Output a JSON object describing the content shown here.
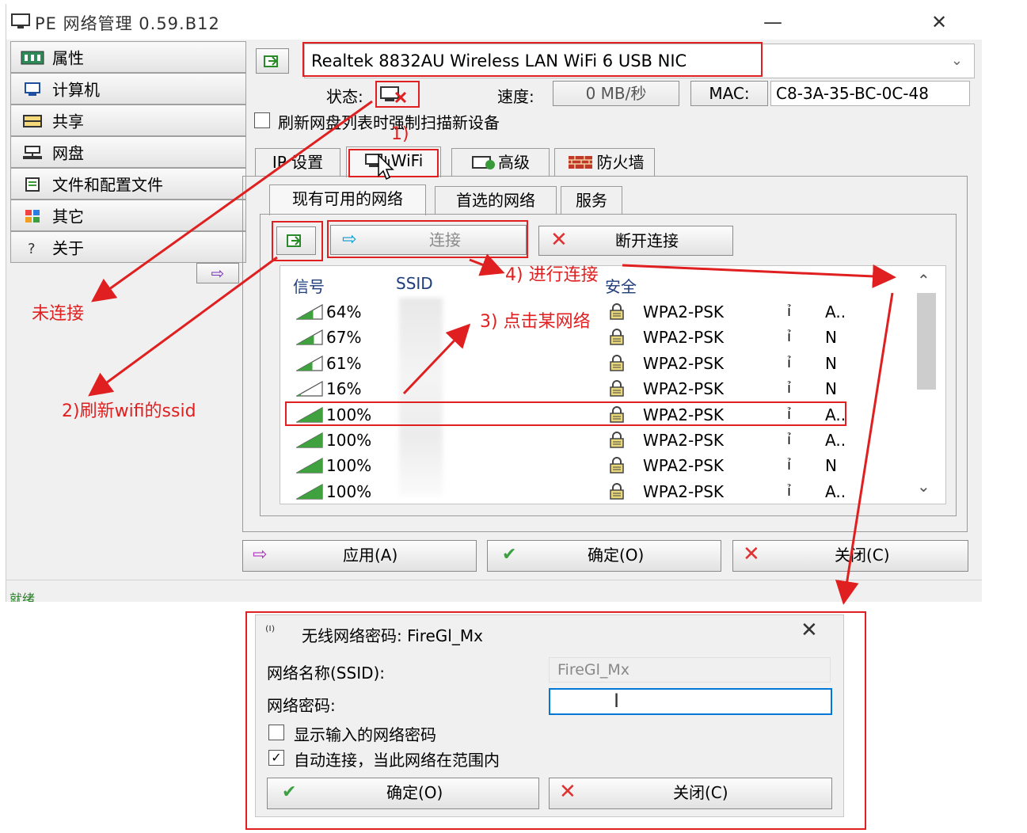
{
  "window": {
    "title": "PE 网络管理 0.59.B12",
    "minimize": "—",
    "close": "✕"
  },
  "sidebar": {
    "items": [
      {
        "label": "属性",
        "icon": "properties-icon"
      },
      {
        "label": "计算机",
        "icon": "computer-icon"
      },
      {
        "label": "共享",
        "icon": "share-icon"
      },
      {
        "label": "网盘",
        "icon": "network-drive-icon"
      },
      {
        "label": "文件和配置文件",
        "icon": "files-icon"
      },
      {
        "label": "其它",
        "icon": "other-icon"
      },
      {
        "label": "关于",
        "icon": "about-icon"
      }
    ],
    "arrow": "⇨"
  },
  "adapter": {
    "name": "Realtek 8832AU Wireless LAN WiFi 6 USB NIC",
    "status_label": "状态:",
    "speed_label": "速度:",
    "speed_value": "0 MB/秒",
    "mac_label": "MAC:",
    "mac_value": "C8-3A-35-BC-0C-48",
    "force_scan_label": "刷新网盘列表时强制扫描新设备"
  },
  "tabs": [
    "IP 设置",
    "WiFi",
    "高级",
    "防火墙"
  ],
  "subtabs": [
    "现有可用的网络",
    "首选的网络",
    "服务"
  ],
  "wifi_buttons": {
    "connect": "连接",
    "disconnect": "断开连接"
  },
  "columns": {
    "signal": "信号",
    "ssid": "SSID",
    "security": "安全"
  },
  "networks": [
    {
      "signal": "64%",
      "security": "WPA2-PSK",
      "extra": "A.."
    },
    {
      "signal": "67%",
      "security": "WPA2-PSK",
      "extra": "N"
    },
    {
      "signal": "61%",
      "security": "WPA2-PSK",
      "extra": "N"
    },
    {
      "signal": "16%",
      "security": "WPA2-PSK",
      "extra": "N"
    },
    {
      "signal": "100%",
      "security": "WPA2-PSK",
      "extra": "A.."
    },
    {
      "signal": "100%",
      "security": "WPA2-PSK",
      "extra": "A.."
    },
    {
      "signal": "100%",
      "security": "WPA2-PSK",
      "extra": "N"
    },
    {
      "signal": "100%",
      "security": "WPA2-PSK",
      "extra": "A.."
    }
  ],
  "bottom_buttons": {
    "apply": "应用(A)",
    "ok": "确定(O)",
    "close": "关闭(C)"
  },
  "statusbar": "就绪",
  "annotations": {
    "step1": "1)",
    "not_connected": "未连接",
    "step2": "2)刷新wifi的ssid",
    "step3": "3) 点击某网络",
    "step4": "4) 进行连接"
  },
  "dialog": {
    "title": "无线网络密码: FireGl_Mx",
    "ssid_label": "网络名称(SSID):",
    "ssid_value": "FireGl_Mx",
    "password_label": "网络密码:",
    "password_value": "",
    "show_password": "显示输入的网络密码",
    "auto_connect": "自动连接，当此网络在范围内",
    "ok": "确定(O)",
    "close": "关闭(C)"
  },
  "colors": {
    "annotation": "#e02020",
    "signal": "#3fa23f",
    "selection": "#0078d7"
  }
}
